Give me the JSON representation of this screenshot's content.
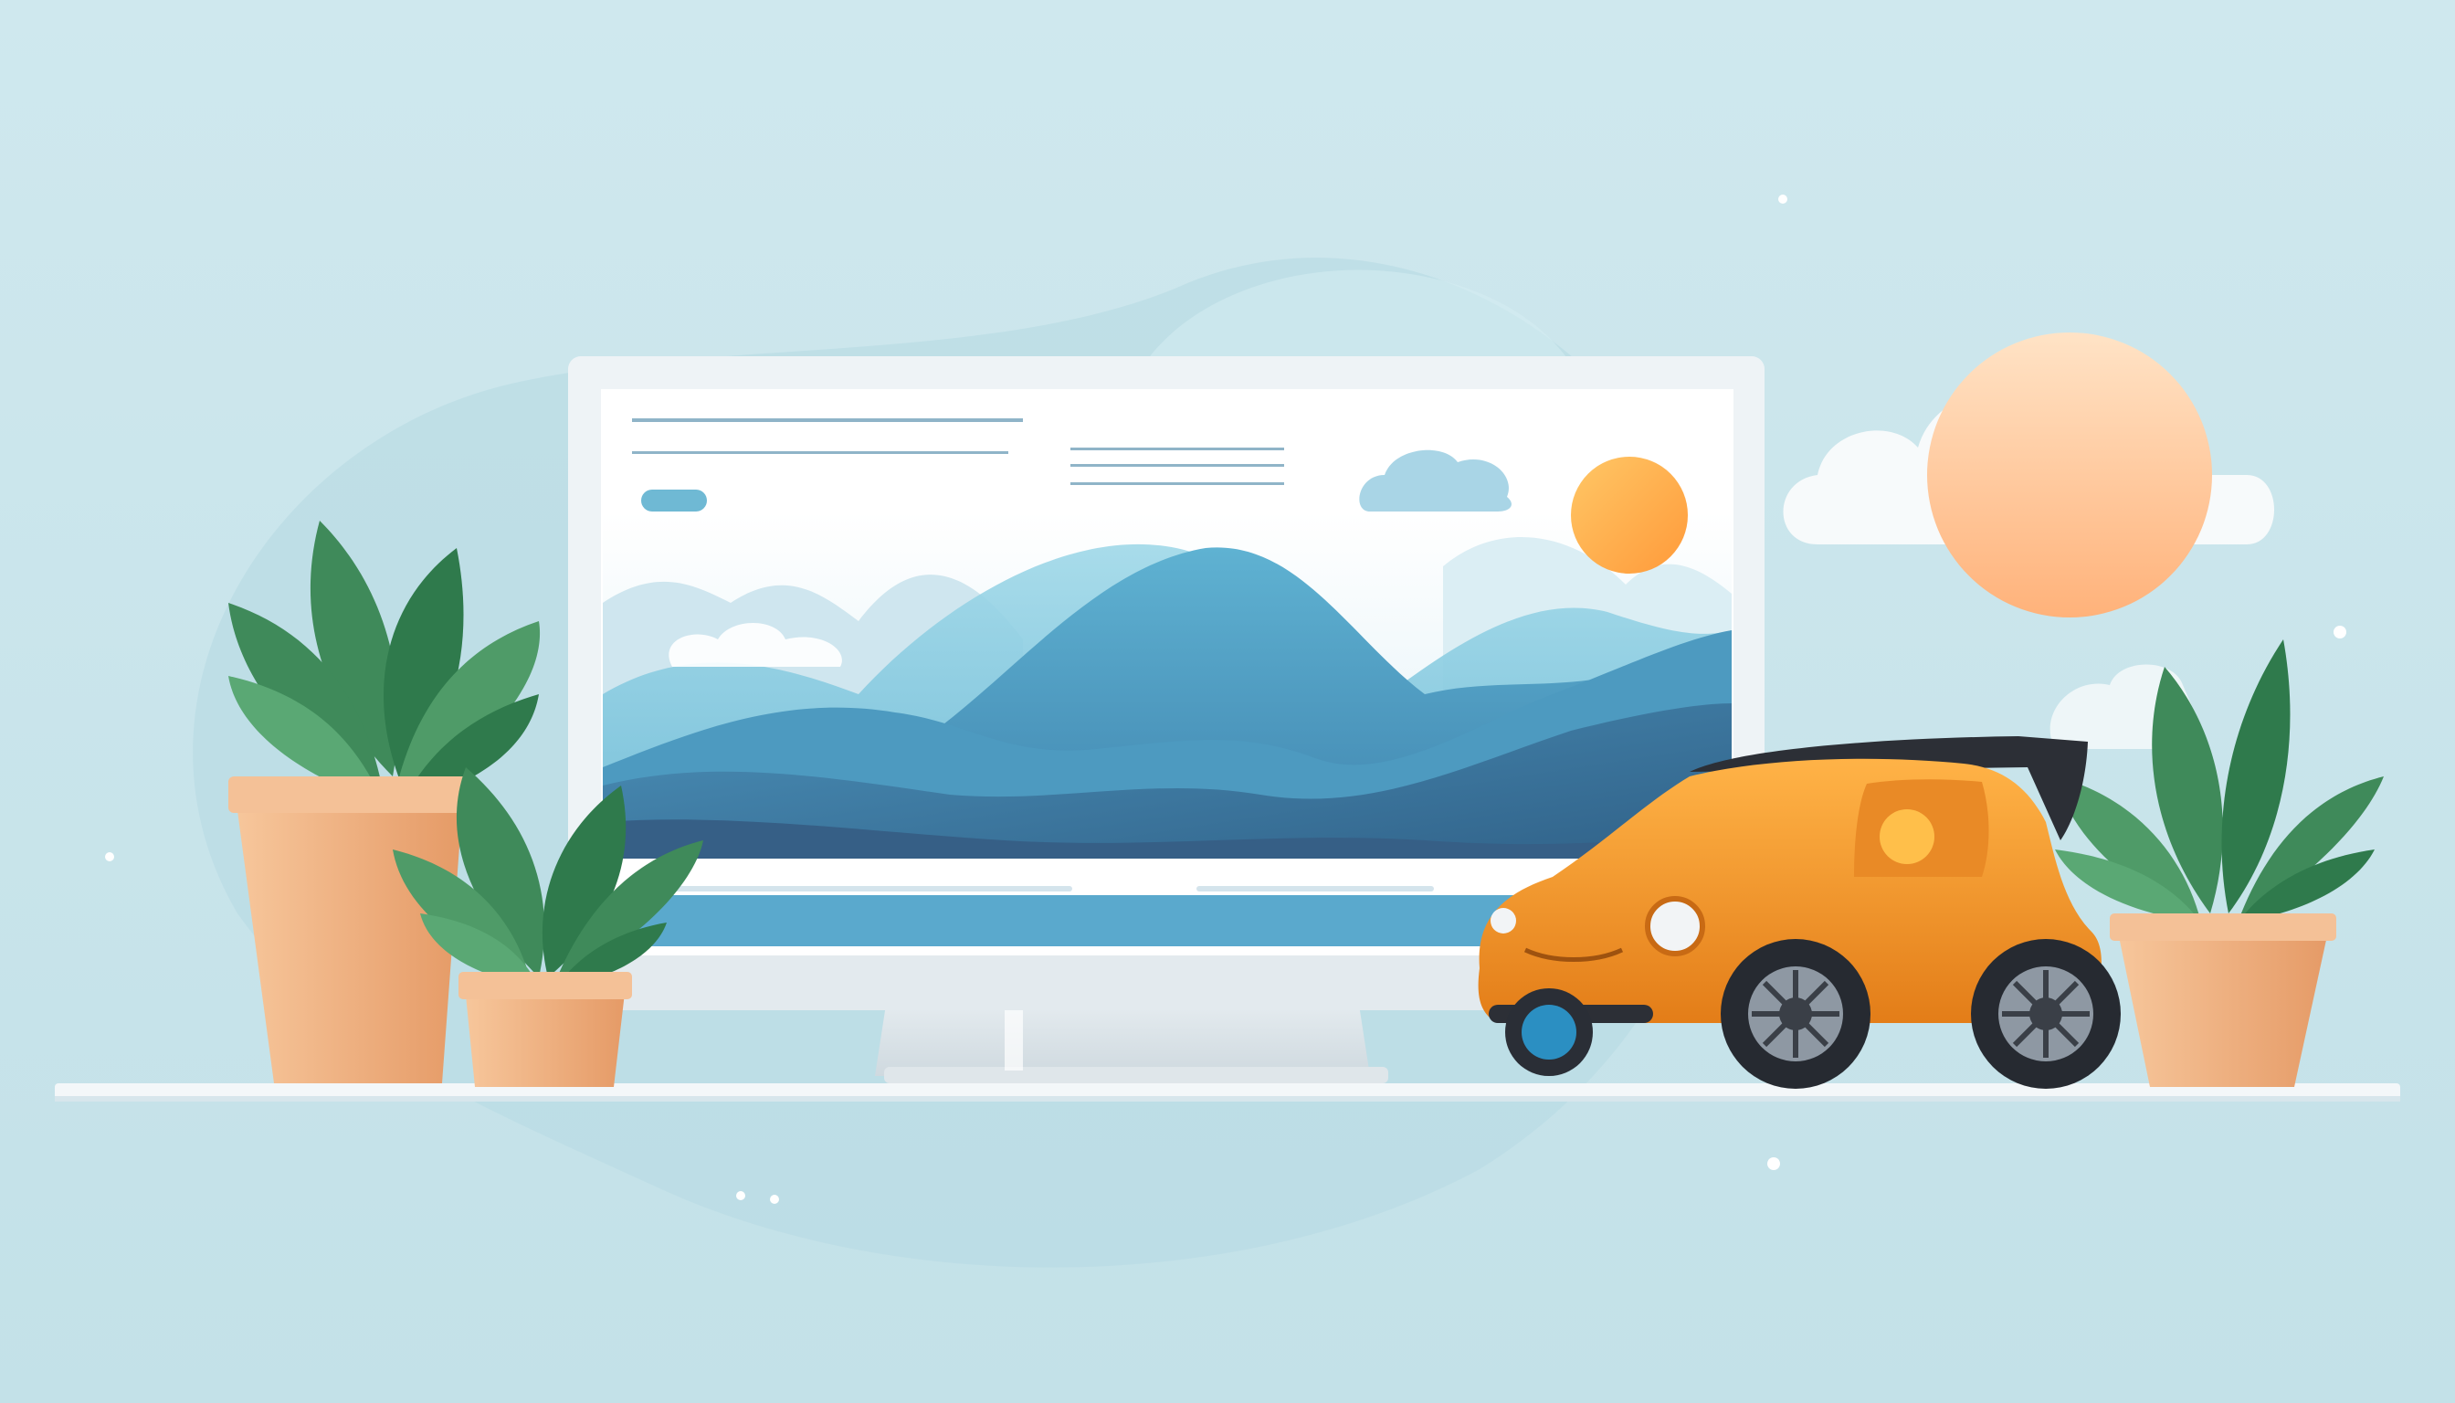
{
  "scene": {
    "description_free": true,
    "colors": {
      "background": "#c9e6ec",
      "blob": "#b7dbe3",
      "monitor_frame": "#eef3f6",
      "monitor_screen": "#ffffff",
      "mountain_dark": "#3f78a0",
      "mountain_mid": "#4f9cc2",
      "mountain_light": "#8ccde0",
      "sun": "#ffc48e",
      "small_sun": "#ffaa44",
      "cloud": "#f7fafb",
      "small_cloud": "#a9d5e6",
      "car_body": "#f39a2c",
      "car_roof": "#2c2f36",
      "pot": "#f1b37f",
      "leaf": "#3f8a5a",
      "shelf": "#f3f7f9"
    },
    "icons": [
      "monitor-icon",
      "mountain-landscape-icon",
      "sun-icon",
      "cloud-icon",
      "car-icon",
      "potted-plant-icon"
    ]
  }
}
